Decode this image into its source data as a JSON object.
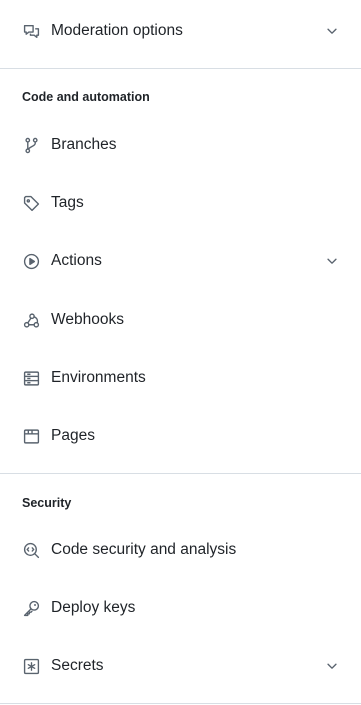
{
  "sidebar": {
    "moderation": {
      "label": "Moderation options",
      "icon": "comment-discussion-icon",
      "expandable": true
    },
    "code_automation": {
      "heading": "Code and automation",
      "items": [
        {
          "label": "Branches",
          "icon": "git-branch-icon"
        },
        {
          "label": "Tags",
          "icon": "tag-icon"
        },
        {
          "label": "Actions",
          "icon": "play-icon",
          "expandable": true
        },
        {
          "label": "Webhooks",
          "icon": "webhook-icon"
        },
        {
          "label": "Environments",
          "icon": "server-icon"
        },
        {
          "label": "Pages",
          "icon": "browser-icon"
        }
      ]
    },
    "security": {
      "heading": "Security",
      "items": [
        {
          "label": "Code security and analysis",
          "icon": "codescan-icon"
        },
        {
          "label": "Deploy keys",
          "icon": "key-icon"
        },
        {
          "label": "Secrets",
          "icon": "key-asterisk-icon",
          "expandable": true
        }
      ]
    }
  },
  "colors": {
    "text": "#1f2328",
    "icon": "#59636e",
    "divider": "#d8dee4",
    "background": "#ffffff"
  }
}
